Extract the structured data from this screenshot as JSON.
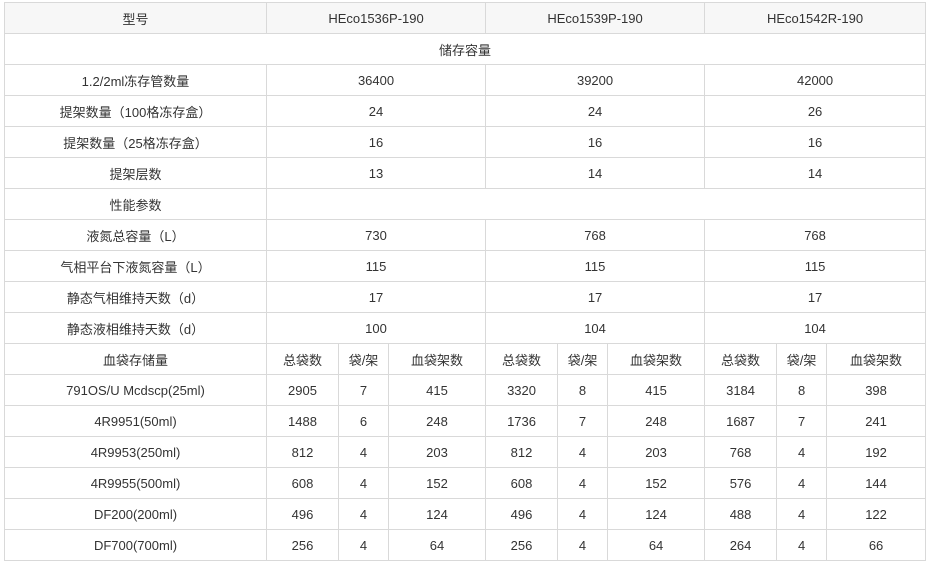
{
  "header": {
    "label": "型号",
    "models": [
      "HEco1536P-190",
      "HEco1539P-190",
      "HEco1542R-190"
    ]
  },
  "storage": {
    "section_title": "储存容量",
    "rows": [
      {
        "label": "1.2/2ml冻存管数量",
        "values": [
          "36400",
          "39200",
          "42000"
        ]
      },
      {
        "label": "提架数量（100格冻存盒）",
        "values": [
          "24",
          "24",
          "26"
        ]
      },
      {
        "label": "提架数量（25格冻存盒）",
        "values": [
          "16",
          "16",
          "16"
        ]
      },
      {
        "label": "提架层数",
        "values": [
          "13",
          "14",
          "14"
        ]
      }
    ]
  },
  "performance": {
    "section_title": "性能参数",
    "rows": [
      {
        "label": "液氮总容量（L）",
        "values": [
          "730",
          "768",
          "768"
        ]
      },
      {
        "label": "气相平台下液氮容量（L）",
        "values": [
          "115",
          "115",
          "115"
        ]
      },
      {
        "label": "静态气相维持天数（d）",
        "values": [
          "17",
          "17",
          "17"
        ]
      },
      {
        "label": "静态液相维持天数（d）",
        "values": [
          "100",
          "104",
          "104"
        ]
      }
    ]
  },
  "bags": {
    "label": "血袋存储量",
    "subheaders": [
      "总袋数",
      "袋/架",
      "血袋架数"
    ],
    "rows": [
      {
        "label": "791OS/U Mcdscp(25ml)",
        "values": [
          "2905",
          "7",
          "415",
          "3320",
          "8",
          "415",
          "3184",
          "8",
          "398"
        ]
      },
      {
        "label": "4R9951(50ml)",
        "values": [
          "1488",
          "6",
          "248",
          "1736",
          "7",
          "248",
          "1687",
          "7",
          "241"
        ]
      },
      {
        "label": "4R9953(250ml)",
        "values": [
          "812",
          "4",
          "203",
          "812",
          "4",
          "203",
          "768",
          "4",
          "192"
        ]
      },
      {
        "label": "4R9955(500ml)",
        "values": [
          "608",
          "4",
          "152",
          "608",
          "4",
          "152",
          "576",
          "4",
          "144"
        ]
      },
      {
        "label": "DF200(200ml)",
        "values": [
          "496",
          "4",
          "124",
          "496",
          "4",
          "124",
          "488",
          "4",
          "122"
        ]
      },
      {
        "label": "DF700(700ml)",
        "values": [
          "256",
          "4",
          "64",
          "256",
          "4",
          "64",
          "264",
          "4",
          "66"
        ]
      }
    ]
  }
}
